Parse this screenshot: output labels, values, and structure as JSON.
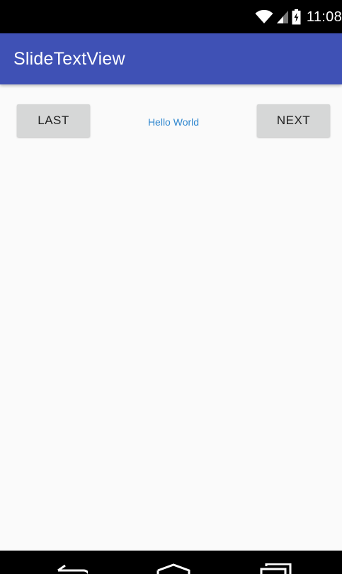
{
  "status_bar": {
    "time": "11:08",
    "icons": [
      "wifi-icon",
      "signal-icon",
      "battery-charging-icon"
    ]
  },
  "app_bar": {
    "title": "SlideTextView",
    "color": "#3f51b5"
  },
  "main": {
    "last_button_label": "LAST",
    "center_text": "Hello World",
    "next_button_label": "NEXT",
    "center_text_color": "#2f87cf"
  },
  "nav_bar": {
    "icons": [
      "back-icon",
      "home-icon",
      "recents-icon"
    ]
  }
}
